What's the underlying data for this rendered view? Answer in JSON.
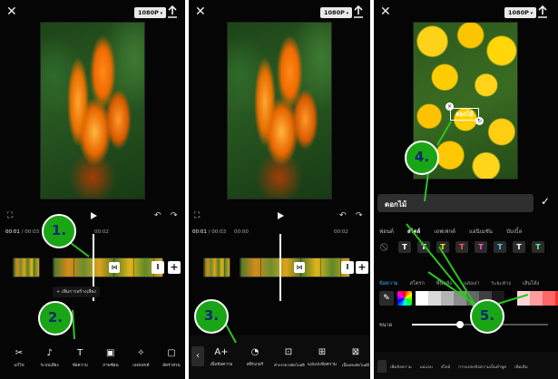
{
  "panels": [
    {
      "resolution": "1080P",
      "time_current": "00:01",
      "time_total": "00:03",
      "ruler": [
        "00:02"
      ],
      "add_audio_label": "+ เพิ่มการสร้างเสียง",
      "toolbar": [
        {
          "icon": "scissors-icon",
          "glyph": "✂",
          "label": "แก้ไข"
        },
        {
          "icon": "music-note-icon",
          "glyph": "♪",
          "label": "ระบบเสียง"
        },
        {
          "icon": "text-icon",
          "glyph": "T",
          "label": "ข้อความ"
        },
        {
          "icon": "picture-in-picture-icon",
          "glyph": "▣",
          "label": "ภาพซ้อน"
        },
        {
          "icon": "effects-icon",
          "glyph": "✧",
          "label": "เอฟเฟกต์"
        },
        {
          "icon": "aspect-ratio-icon",
          "glyph": "▢",
          "label": "อัตราส่วน"
        }
      ],
      "markers": [
        "1.",
        "2."
      ]
    },
    {
      "resolution": "1080P",
      "time_current": "00:01",
      "time_total": "00:03",
      "ruler": [
        "00:00",
        "00:02"
      ],
      "toolbar": [
        {
          "icon": "add-text-icon",
          "glyph": "A+",
          "label": "เพิ่มข้อความ"
        },
        {
          "icon": "sticker-icon",
          "glyph": "◔",
          "label": "สติกเกอร์"
        },
        {
          "icon": "auto-captions-icon",
          "glyph": "⊡",
          "label": "คำบรรยายอัตโนมัติ"
        },
        {
          "icon": "text-template-icon",
          "glyph": "⊞",
          "label": "แม่แบบข้อความ"
        },
        {
          "icon": "lyrics-icon",
          "glyph": "⊠",
          "label": "เนื้อเพลงอัตโนมัติ"
        }
      ],
      "markers": [
        "3."
      ]
    },
    {
      "resolution": "1080P",
      "overlay_text": "ดอกไม้",
      "input_value": "ดอกไม้",
      "tabs": [
        "ฟอนต์",
        "สไตล์",
        "เอฟเฟกต์",
        "แอนิเมชัน",
        "บับเบิ้ล"
      ],
      "active_tab": "สไตล์",
      "subtabs": [
        "ข้อความ",
        "สโตรก",
        "พื้นหลัง",
        "แสงเงา",
        "ระยะห่าง",
        "เส้นโค้ง"
      ],
      "active_subtab": "ข้อความ",
      "size_label": "ขนาด",
      "size_value": 0.35,
      "style_colors": [
        "#ffffff",
        "#ffffff",
        "#ffe600",
        "#ff5a5a",
        "#ff5ad0",
        "#59c8ff",
        "#ffffff",
        "#59ff8a"
      ],
      "palette": [
        "#ffffff",
        "#d9d9d9",
        "#b3b3b3",
        "#8c8c8c",
        "#666666",
        "#404040",
        "#1a1a1a",
        "#000000",
        "#ffd6d6",
        "#ff9e9e",
        "#ff6666",
        "#ff2e2e",
        "#e60000",
        "#b30000"
      ],
      "bottom_labels": [
        "เพิ่มข้อความ",
        "แม่แบบ",
        "สไตล์",
        "การแปลงข้อความเป็นคำพูด",
        "เพิ่มเติม"
      ],
      "markers": [
        "4.",
        "5."
      ]
    }
  ]
}
